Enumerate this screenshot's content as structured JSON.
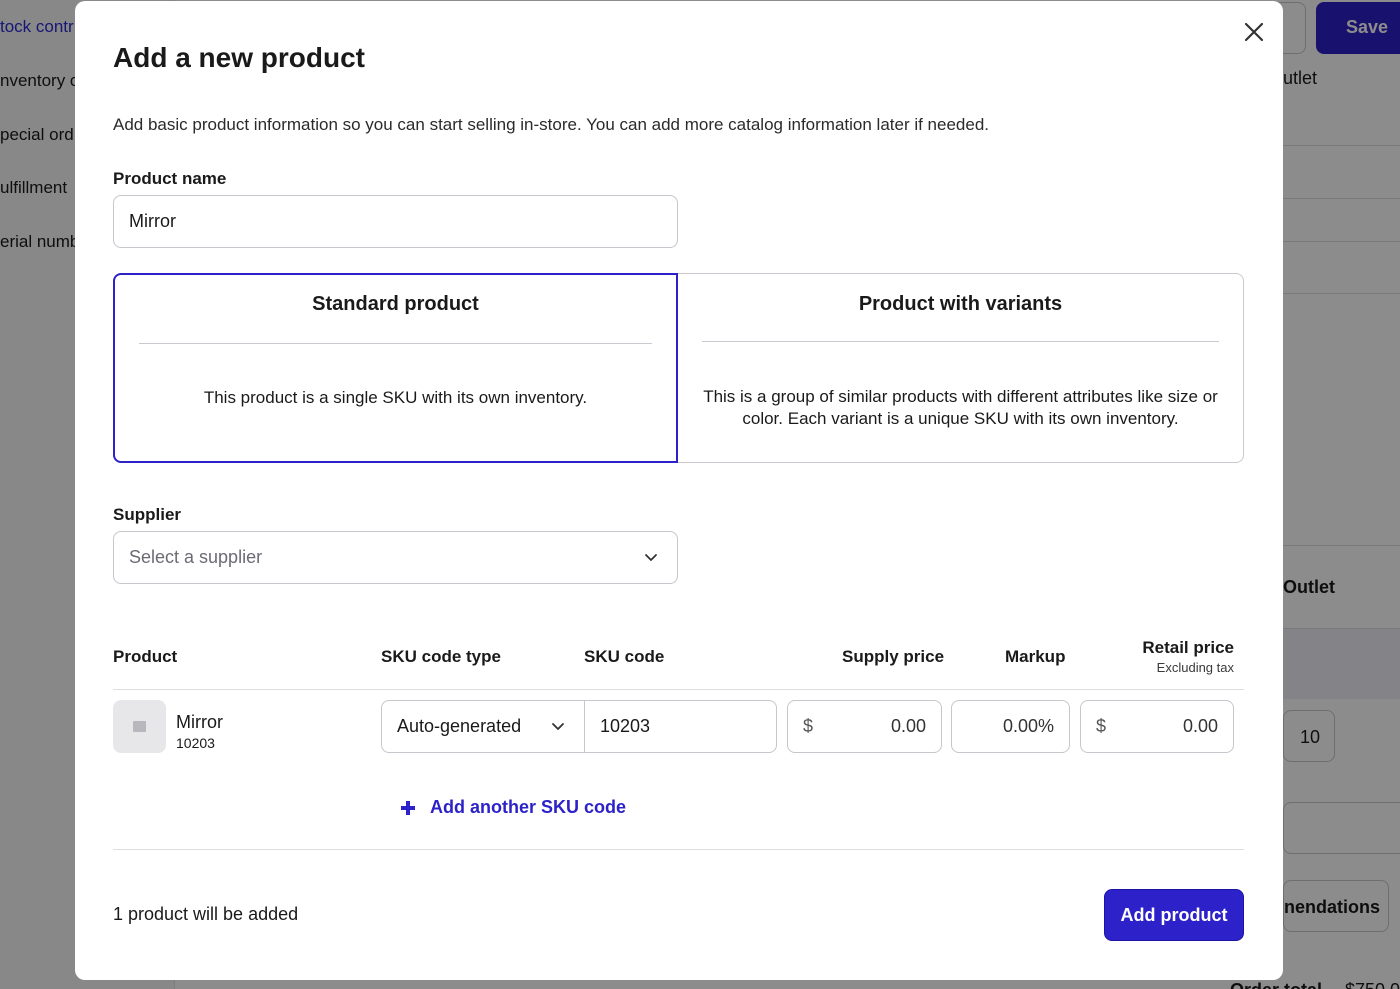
{
  "background": {
    "sidebar_items": [
      "tock contr",
      "nventory c",
      "pecial ord",
      "ulfillment",
      "erial numb"
    ],
    "save_label": "Save",
    "outlet_top": "utlet",
    "outlet_header": "Outlet",
    "quantity": "10",
    "recommendations": "nendations",
    "order_total": "Order total",
    "order_total_value": "$750.0"
  },
  "modal": {
    "title": "Add a new product",
    "description": "Add basic product information so you can start selling in-store. You can add more catalog information later if needed.",
    "product_name": {
      "label": "Product name",
      "value": "Mirror"
    },
    "types": [
      {
        "title": "Standard product",
        "description": "This product is a single SKU with its own inventory.",
        "selected": true
      },
      {
        "title": "Product with variants",
        "description": "This is a group of similar products with different attributes like size or color. Each variant is a unique SKU with its own inventory.",
        "selected": false
      }
    ],
    "supplier": {
      "label": "Supplier",
      "placeholder": "Select a supplier"
    },
    "table": {
      "headers": {
        "product": "Product",
        "sku_type": "SKU code type",
        "sku_code": "SKU code",
        "supply_price": "Supply price",
        "markup": "Markup",
        "retail_price": "Retail price",
        "retail_note": "Excluding tax"
      },
      "row": {
        "name": "Mirror",
        "sku": "10203",
        "sku_type": "Auto-generated",
        "sku_code": "10203",
        "currency": "$",
        "supply_price": "0.00",
        "markup": "0.00",
        "markup_unit": "%",
        "retail_price": "0.00"
      }
    },
    "add_sku_label": "Add another SKU code",
    "footer_summary": "1 product will be added",
    "submit_label": "Add product"
  },
  "colors": {
    "primary": "#2d22c9",
    "overlay": "rgba(0,0,0,0.45)"
  },
  "icons": [
    "close-icon",
    "chevron-down-icon",
    "plus-icon",
    "image-placeholder-icon"
  ]
}
